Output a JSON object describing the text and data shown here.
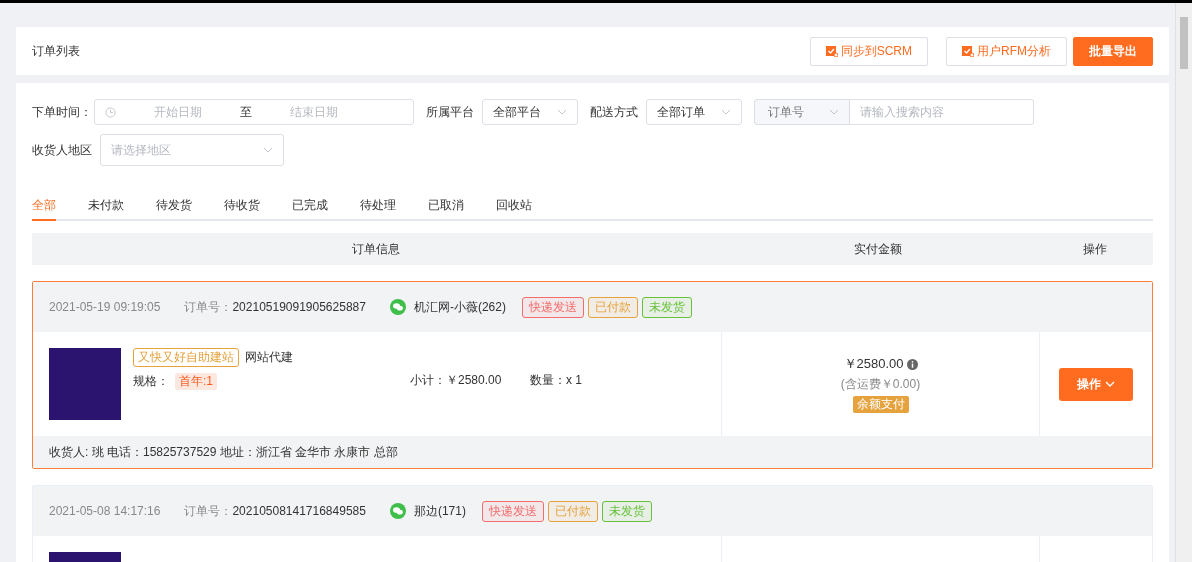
{
  "header": {
    "title": "订单列表",
    "buttons": [
      {
        "label": "同步到SCRM",
        "kind": "outline"
      },
      {
        "label": "用户RFM分析",
        "kind": "outline"
      },
      {
        "label": "批量导出",
        "kind": "primary"
      }
    ]
  },
  "filters": {
    "date": {
      "label": "下单时间：",
      "start_placeholder": "开始日期",
      "separator": "至",
      "end_placeholder": "结束日期"
    },
    "platform": {
      "label": "所属平台",
      "value": "全部平台"
    },
    "delivery": {
      "label": "配送方式",
      "value": "全部订单"
    },
    "search": {
      "field": "订单号",
      "placeholder": "请输入搜索内容"
    },
    "region": {
      "label": "收货人地区",
      "placeholder": "请选择地区"
    }
  },
  "tabs": [
    {
      "label": "全部",
      "selected": true
    },
    {
      "label": "未付款",
      "selected": false
    },
    {
      "label": "待发货",
      "selected": false
    },
    {
      "label": "待收货",
      "selected": false
    },
    {
      "label": "已完成",
      "selected": false
    },
    {
      "label": "待处理",
      "selected": false
    },
    {
      "label": "已取消",
      "selected": false
    },
    {
      "label": "回收站",
      "selected": false
    }
  ],
  "table": {
    "columns": [
      "订单信息",
      "实付金额",
      "操作"
    ],
    "orders": [
      {
        "selected": true,
        "time": "2021-05-19 09:19:05",
        "order_no_label": "订单号：",
        "order_no": "20210519091905625887",
        "buyer": "机汇网-小薇(262)",
        "tags": [
          {
            "label": "快递发送",
            "color": "#f56c6c"
          },
          {
            "label": "已付款",
            "color": "#e6a23c"
          },
          {
            "label": "未发货",
            "color": "#67c23a"
          }
        ],
        "product": {
          "tag": "又快又好自助建站",
          "name": "网站代建",
          "spec_label": "规格：",
          "spec": "首年:1",
          "subtotal": "小计：￥2580.00",
          "quantity": "数量：x 1"
        },
        "amount": "￥2580.00",
        "shipping": "(含运费￥0.00)",
        "payment": "余额支付",
        "action": "操作",
        "recipient": "收货人: 珧 电话：15825737529 地址：浙江省 金华市 永康市 总部"
      },
      {
        "selected": false,
        "time": "2021-05-08 14:17:16",
        "order_no_label": "订单号：",
        "order_no": "20210508141716849585",
        "buyer": "那边(171)",
        "tags": [
          {
            "label": "快递发送",
            "color": "#f56c6c"
          },
          {
            "label": "已付款",
            "color": "#e6a23c"
          },
          {
            "label": "未发货",
            "color": "#67c23a"
          }
        ]
      }
    ]
  }
}
